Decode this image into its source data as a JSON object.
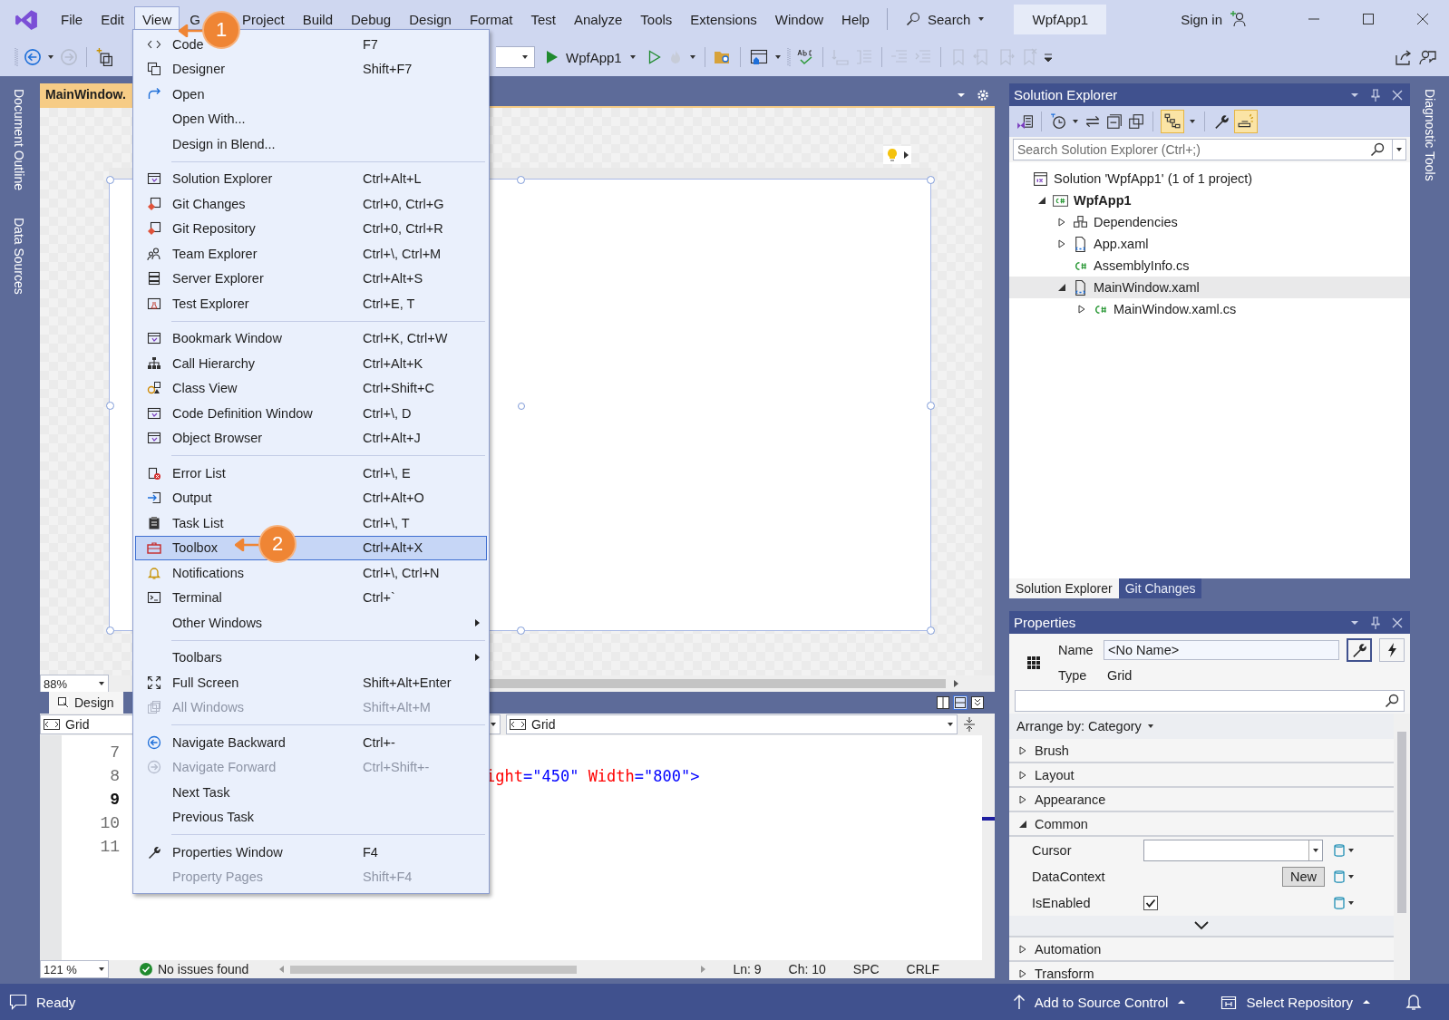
{
  "menu_bar": {
    "items": [
      {
        "label": "File",
        "selected": false
      },
      {
        "label": "Edit",
        "selected": false
      },
      {
        "label": "View",
        "selected": true
      },
      {
        "label": "G",
        "selected": false
      },
      {
        "label": "Project",
        "selected": false
      },
      {
        "label": "Build",
        "selected": false
      },
      {
        "label": "Debug",
        "selected": false
      },
      {
        "label": "Design",
        "selected": false
      },
      {
        "label": "Format",
        "selected": false
      },
      {
        "label": "Test",
        "selected": false
      },
      {
        "label": "Analyze",
        "selected": false
      },
      {
        "label": "Tools",
        "selected": false
      },
      {
        "label": "Extensions",
        "selected": false
      },
      {
        "label": "Window",
        "selected": false
      },
      {
        "label": "Help",
        "selected": false
      }
    ],
    "search": "Search",
    "solution_name": "WpfApp1",
    "sign_in": "Sign in"
  },
  "toolbar": {
    "start_target": "WpfApp1"
  },
  "left_tool_tabs": [
    "Document Outline",
    "Data Sources"
  ],
  "right_tool_tabs": [
    "Diagnostic Tools"
  ],
  "document_tab": {
    "title": "MainWindow."
  },
  "designer": {
    "zoom": "88%",
    "view_tab": "Design"
  },
  "code_nav": {
    "left": "Grid",
    "right": "Grid"
  },
  "code": {
    "lines": [
      {
        "number": "7",
        "current": false
      },
      {
        "number": "8",
        "current": false,
        "tokens": [
          {
            "kind": "attribute",
            "text": "ight"
          },
          {
            "kind": "punct",
            "text": "="
          },
          {
            "kind": "value",
            "text": "\"450\""
          },
          {
            "kind": "attribute",
            "text": " Width"
          },
          {
            "kind": "punct",
            "text": "="
          },
          {
            "kind": "value",
            "text": "\"800\""
          },
          {
            "kind": "punct",
            "text": ">"
          }
        ]
      },
      {
        "number": "9",
        "current": true
      },
      {
        "number": "10",
        "current": false
      },
      {
        "number": "11",
        "current": false
      }
    ]
  },
  "editor_status": {
    "zoom": "121 %",
    "issues": "No issues found",
    "line": "Ln: 9",
    "column": "Ch: 10",
    "whitespace": "SPC",
    "line_ending": "CRLF"
  },
  "view_menu": {
    "groups": [
      [
        {
          "label": "Code",
          "shortcut": "F7",
          "disabled": false,
          "selected": false,
          "submenu": false
        },
        {
          "label": "Designer",
          "shortcut": "Shift+F7",
          "disabled": false,
          "selected": false,
          "submenu": false
        },
        {
          "label": "Open",
          "disabled": false,
          "selected": false,
          "submenu": false
        },
        {
          "label": "Open With...",
          "disabled": false,
          "selected": false,
          "submenu": false
        },
        {
          "label": "Design in Blend...",
          "disabled": false,
          "selected": false,
          "submenu": false
        }
      ],
      [
        {
          "label": "Solution Explorer",
          "shortcut": "Ctrl+Alt+L",
          "disabled": false,
          "selected": false,
          "submenu": false
        },
        {
          "label": "Git Changes",
          "shortcut": "Ctrl+0, Ctrl+G",
          "disabled": false,
          "selected": false,
          "submenu": false
        },
        {
          "label": "Git Repository",
          "shortcut": "Ctrl+0, Ctrl+R",
          "disabled": false,
          "selected": false,
          "submenu": false
        },
        {
          "label": "Team Explorer",
          "shortcut": "Ctrl+\\, Ctrl+M",
          "disabled": false,
          "selected": false,
          "submenu": false
        },
        {
          "label": "Server Explorer",
          "shortcut": "Ctrl+Alt+S",
          "disabled": false,
          "selected": false,
          "submenu": false
        },
        {
          "label": "Test Explorer",
          "shortcut": "Ctrl+E, T",
          "disabled": false,
          "selected": false,
          "submenu": false
        }
      ],
      [
        {
          "label": "Bookmark Window",
          "shortcut": "Ctrl+K, Ctrl+W",
          "disabled": false,
          "selected": false,
          "submenu": false
        },
        {
          "label": "Call Hierarchy",
          "shortcut": "Ctrl+Alt+K",
          "disabled": false,
          "selected": false,
          "submenu": false
        },
        {
          "label": "Class View",
          "shortcut": "Ctrl+Shift+C",
          "disabled": false,
          "selected": false,
          "submenu": false
        },
        {
          "label": "Code Definition Window",
          "shortcut": "Ctrl+\\, D",
          "disabled": false,
          "selected": false,
          "submenu": false
        },
        {
          "label": "Object Browser",
          "shortcut": "Ctrl+Alt+J",
          "disabled": false,
          "selected": false,
          "submenu": false
        }
      ],
      [
        {
          "label": "Error List",
          "shortcut": "Ctrl+\\, E",
          "disabled": false,
          "selected": false,
          "submenu": false
        },
        {
          "label": "Output",
          "shortcut": "Ctrl+Alt+O",
          "disabled": false,
          "selected": false,
          "submenu": false
        },
        {
          "label": "Task List",
          "shortcut": "Ctrl+\\, T",
          "disabled": false,
          "selected": false,
          "submenu": false
        },
        {
          "label": "Toolbox",
          "shortcut": "Ctrl+Alt+X",
          "disabled": false,
          "selected": true,
          "submenu": false
        },
        {
          "label": "Notifications",
          "shortcut": "Ctrl+\\, Ctrl+N",
          "disabled": false,
          "selected": false,
          "submenu": false
        },
        {
          "label": "Terminal",
          "shortcut": "Ctrl+`",
          "disabled": false,
          "selected": false,
          "submenu": false
        },
        {
          "label": "Other Windows",
          "disabled": false,
          "selected": false,
          "submenu": true
        }
      ],
      [
        {
          "label": "Toolbars",
          "disabled": false,
          "selected": false,
          "submenu": true
        },
        {
          "label": "Full Screen",
          "shortcut": "Shift+Alt+Enter",
          "disabled": false,
          "selected": false,
          "submenu": false
        },
        {
          "label": "All Windows",
          "shortcut": "Shift+Alt+M",
          "disabled": true,
          "selected": false,
          "submenu": false
        }
      ],
      [
        {
          "label": "Navigate Backward",
          "shortcut": "Ctrl+-",
          "disabled": false,
          "selected": false,
          "submenu": false
        },
        {
          "label": "Navigate Forward",
          "shortcut": "Ctrl+Shift+-",
          "disabled": true,
          "selected": false,
          "submenu": false
        },
        {
          "label": "Next Task",
          "disabled": false,
          "selected": false,
          "submenu": false
        },
        {
          "label": "Previous Task",
          "disabled": false,
          "selected": false,
          "submenu": false
        }
      ],
      [
        {
          "label": "Properties Window",
          "shortcut": "F4",
          "disabled": false,
          "selected": false,
          "submenu": false
        },
        {
          "label": "Property Pages",
          "shortcut": "Shift+F4",
          "disabled": true,
          "selected": false,
          "submenu": false
        }
      ]
    ]
  },
  "callouts": [
    {
      "number": "1"
    },
    {
      "number": "2"
    }
  ],
  "solution_explorer": {
    "title": "Solution Explorer",
    "toolbar": [
      {
        "kind": "switch-views",
        "on": false
      },
      {
        "kind": "history",
        "on": false
      },
      {
        "kind": "sync",
        "on": false
      },
      {
        "kind": "collapse",
        "on": false
      },
      {
        "kind": "copy",
        "on": false
      },
      {
        "kind": "tree",
        "on": true
      },
      {
        "kind": "properties",
        "on": false
      },
      {
        "kind": "preview",
        "on": true
      }
    ],
    "search_placeholder": "Search Solution Explorer (Ctrl+;)",
    "tree": [
      {
        "label": "Solution 'WpfApp1' (1 of 1 project)",
        "kind": "solution",
        "expandable": false,
        "selected": false,
        "startup": false,
        "children": [
          {
            "label": "WpfApp1",
            "kind": "project",
            "expandable": true,
            "expanded": true,
            "selected": false,
            "startup": true,
            "children": [
              {
                "label": "Dependencies",
                "kind": "dependencies",
                "expandable": true,
                "expanded": false,
                "selected": false,
                "startup": false
              },
              {
                "label": "App.xaml",
                "kind": "xaml",
                "expandable": true,
                "expanded": false,
                "selected": false,
                "startup": false
              },
              {
                "label": "AssemblyInfo.cs",
                "kind": "csharp",
                "expandable": false,
                "selected": false,
                "startup": false
              },
              {
                "label": "MainWindow.xaml",
                "kind": "xaml",
                "expandable": true,
                "expanded": true,
                "selected": true,
                "startup": false,
                "children": [
                  {
                    "label": "MainWindow.xaml.cs",
                    "kind": "csharp",
                    "expandable": true,
                    "expanded": false,
                    "selected": false,
                    "startup": false
                  }
                ]
              }
            ]
          }
        ]
      }
    ],
    "tabs": [
      {
        "label": "Solution Explorer",
        "selected": true
      },
      {
        "label": "Git Changes",
        "selected": false
      }
    ]
  },
  "properties": {
    "title": "Properties",
    "name_label": "Name",
    "name_value": "<No Name>",
    "type_label": "Type",
    "type_value": "Grid",
    "arrange": "Arrange by: Category",
    "categories": [
      {
        "label": "Brush",
        "expanded": false
      },
      {
        "label": "Layout",
        "expanded": false
      },
      {
        "label": "Appearance",
        "expanded": false
      },
      {
        "label": "Common",
        "expanded": true,
        "properties": [
          {
            "label": "Cursor",
            "kind": "combo"
          },
          {
            "label": "DataContext",
            "kind": "button",
            "button": "New"
          },
          {
            "label": "IsEnabled",
            "kind": "checkbox",
            "checked": true
          }
        ]
      },
      {
        "label": "Automation",
        "expanded": false
      },
      {
        "label": "Transform",
        "expanded": false
      }
    ]
  },
  "status_bar": {
    "message": "Ready",
    "source_control": "Add to Source Control",
    "repository": "Select Repository"
  }
}
